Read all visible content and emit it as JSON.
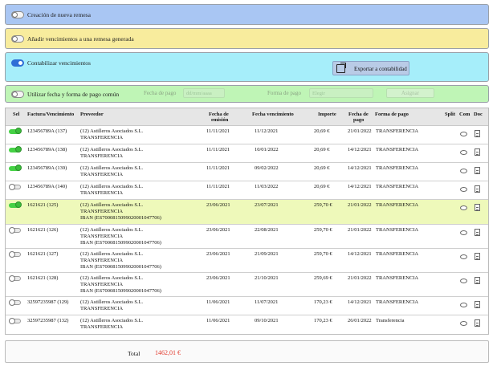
{
  "panels": {
    "creacion": {
      "label": "Creación de nueva remesa",
      "on": false
    },
    "anadir": {
      "label": "Añadir vencimientos a una remesa generada",
      "on": false
    },
    "contabilizar": {
      "label": "Contabilizar vencimientos",
      "on": true,
      "export_label": "Exportar a contabilidad"
    },
    "utilizar": {
      "label": "Utilizar fecha y forma de pago común",
      "on": false,
      "fecha_label": "Fecha de pago",
      "fecha_value": "dd/mm/aaaa",
      "forma_label": "Forma de pago",
      "forma_value": "Elegir",
      "asignar_label": "Asignar"
    }
  },
  "table": {
    "headers": {
      "sel": "Sel",
      "factura": "Factura/Vencimiento",
      "proveedor": "Proveedor",
      "emision": [
        "Fecha de",
        "emisión"
      ],
      "vencimiento": "Fecha vencimiento",
      "importe": "Importe",
      "pago": [
        "Fecha de",
        "pago"
      ],
      "forma": "Forma de pago",
      "split": "Split",
      "com": "Com",
      "doc": "Doc"
    },
    "rows": [
      {
        "sel": true,
        "factura": "123456789A (137)",
        "proveedor": [
          "(12) Astilleros Asociados S.L.",
          "TRANSFERENCIA"
        ],
        "emision": "11/11/2021",
        "vencimiento": "11/12/2021",
        "importe": "20,69 €",
        "pago": "21/01/2022",
        "forma": "TRANSFERENCIA",
        "highlight": false
      },
      {
        "sel": true,
        "factura": "123456789A (138)",
        "proveedor": [
          "(12) Astilleros Asociados S.L.",
          "TRANSFERENCIA"
        ],
        "emision": "11/11/2021",
        "vencimiento": "10/01/2022",
        "importe": "20,69 €",
        "pago": "14/12/2021",
        "forma": "TRANSFERENCIA",
        "highlight": false
      },
      {
        "sel": true,
        "factura": "123456789A (139)",
        "proveedor": [
          "(12) Astilleros Asociados S.L.",
          "TRANSFERENCIA"
        ],
        "emision": "11/11/2021",
        "vencimiento": "09/02/2022",
        "importe": "20,69 €",
        "pago": "14/12/2021",
        "forma": "TRANSFERENCIA",
        "highlight": false
      },
      {
        "sel": false,
        "factura": "123456789A (140)",
        "proveedor": [
          "(12) Astilleros Asociados S.L.",
          "TRANSFERENCIA"
        ],
        "emision": "11/11/2021",
        "vencimiento": "11/03/2022",
        "importe": "20,69 €",
        "pago": "14/12/2021",
        "forma": "TRANSFERENCIA",
        "highlight": false
      },
      {
        "sel": true,
        "factura": "1621621 (125)",
        "proveedor": [
          "(12) Astilleros Asociados S.L.",
          "TRANSFERENCIA",
          "IBAN (ES7000815099020001047706)"
        ],
        "emision": "23/06/2021",
        "vencimiento": "23/07/2021",
        "importe": "259,70 €",
        "pago": "21/01/2022",
        "forma": "TRANSFERENCIA",
        "highlight": true
      },
      {
        "sel": false,
        "factura": "1621621 (126)",
        "proveedor": [
          "(12) Astilleros Asociados S.L.",
          "TRANSFERENCIA",
          "IBAN (ES7000815099020001047706)"
        ],
        "emision": "23/06/2021",
        "vencimiento": "22/08/2021",
        "importe": "259,70 €",
        "pago": "21/01/2022",
        "forma": "TRANSFERENCIA",
        "highlight": false
      },
      {
        "sel": false,
        "factura": "1621621 (127)",
        "proveedor": [
          "(12) Astilleros Asociados S.L.",
          "TRANSFERENCIA",
          "IBAN (ES7000815099020001047706)"
        ],
        "emision": "23/06/2021",
        "vencimiento": "21/09/2021",
        "importe": "259,70 €",
        "pago": "14/12/2021",
        "forma": "TRANSFERENCIA",
        "highlight": false
      },
      {
        "sel": false,
        "factura": "1621621 (128)",
        "proveedor": [
          "(12) Astilleros Asociados S.L.",
          "TRANSFERENCIA",
          "IBAN (ES7000815099020001047706)"
        ],
        "emision": "23/06/2021",
        "vencimiento": "21/10/2021",
        "importe": "259,69 €",
        "pago": "21/01/2022",
        "forma": "TRANSFERENCIA",
        "highlight": false
      },
      {
        "sel": false,
        "factura": "32597235987 (129)",
        "proveedor": [
          "(12) Astilleros Asociados S.L.",
          "TRANSFERENCIA"
        ],
        "emision": "11/06/2021",
        "vencimiento": "11/07/2021",
        "importe": "170,23 €",
        "pago": "14/12/2021",
        "forma": "TRANSFERENCIA",
        "highlight": false
      },
      {
        "sel": false,
        "factura": "32597235987 (132)",
        "proveedor": [
          "(12) Astilleros Asociados S.L.",
          "TRANSFERENCIA"
        ],
        "emision": "11/06/2021",
        "vencimiento": "09/10/2021",
        "importe": "170,23 €",
        "pago": "26/01/2022",
        "forma": "Transferencia",
        "highlight": false
      }
    ]
  },
  "total": {
    "label": "Total",
    "value": "1462,01 €"
  },
  "colors": {
    "total_value": "#e23b2e",
    "highlight_row": "#eef9ba",
    "toggle_on": "#2f6fd6",
    "switch_on": "#45d145"
  }
}
